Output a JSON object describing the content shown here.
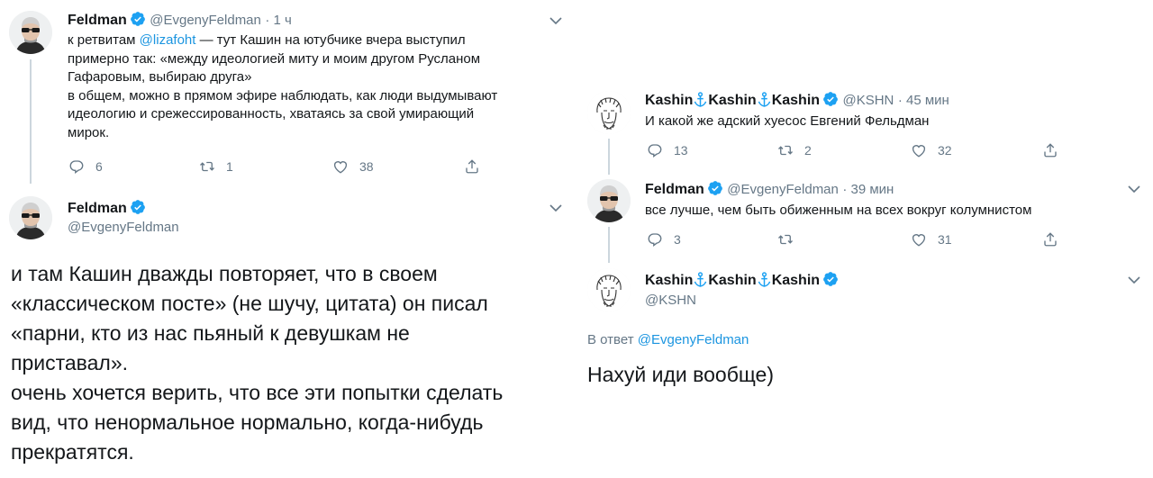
{
  "left": {
    "tweet1": {
      "name": "Feldman",
      "handle": "@EvgenyFeldman",
      "time": "· 1 ч",
      "line1_pre": "к ретвитам ",
      "line1_mention": "@lizafoht",
      "line1_post": " — тут Кашин на ютубчике вчера выступил",
      "line2": "примерно так: «между идеологией миту и моим другом Русланом",
      "line3": "Гафаровым, выбираю друга»",
      "line4": "в общем, можно в прямом эфире наблюдать, как люди выдумывают",
      "line5": "идеологию и срежессированность, хватаясь за свой умирающий",
      "line6": "мирок.",
      "replies": "6",
      "retweets": "1",
      "likes": "38"
    },
    "tweet2": {
      "name": "Feldman",
      "handle": "@EvgenyFeldman",
      "lines": [
        "и там Кашин дважды повторяет, что в своем",
        "«классическом посте» (не шучу, цитата) он писал",
        "«парни, кто из нас пьяный к девушкам не",
        "приставал».",
        "очень хочется верить, что все эти попытки сделать",
        "вид, что ненормальное нормально, когда-нибудь",
        "прекратятся."
      ]
    }
  },
  "right": {
    "tweet1": {
      "name_parts": [
        "Kashin",
        "Kashin",
        "Kashin"
      ],
      "handle": "@KSHN",
      "time": "· 45 мин",
      "text": "И какой же адский хуесос Евгений Фельдман",
      "replies": "13",
      "retweets": "2",
      "likes": "32"
    },
    "tweet2": {
      "name": "Feldman",
      "handle": "@EvgenyFeldman",
      "time": "· 39 мин",
      "text": "все лучше, чем быть обиженным на всех вокруг колумнистом",
      "replies": "3",
      "retweets": "",
      "likes": "31"
    },
    "tweet3": {
      "name_parts": [
        "Kashin",
        "Kashin",
        "Kashin"
      ],
      "handle": "@KSHN",
      "reply_label": "В ответ ",
      "reply_mention": "@EvgenyFeldman",
      "text": "Нахуй иди вообще)"
    }
  },
  "colors": {
    "text": "#14171a",
    "secondary": "#657786",
    "link": "#1b95e0",
    "verified": "#1da1f2",
    "thread_line": "#ccd6dd"
  }
}
